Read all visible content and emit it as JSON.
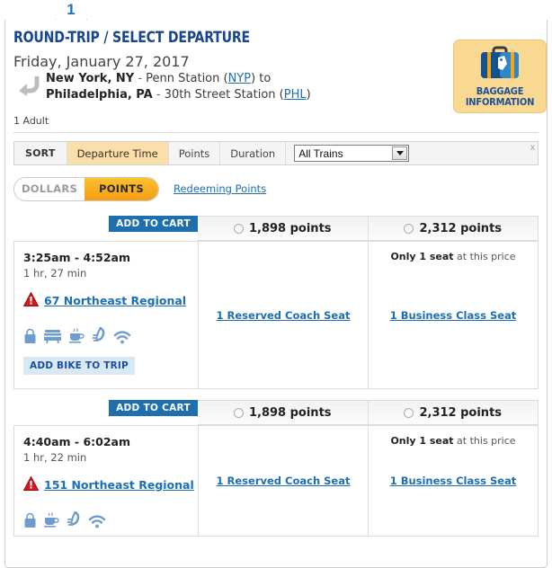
{
  "step": {
    "number": "1"
  },
  "header": {
    "title": "ROUND-TRIP / SELECT DEPARTURE",
    "date": "Friday, January 27, 2017",
    "origin_city": "New York, NY",
    "origin_sep": " - ",
    "origin_station": "Penn Station (",
    "origin_code": "NYP",
    "origin_tail": ") to",
    "dest_city": "Philadelphia, PA",
    "dest_sep": " - ",
    "dest_station": "30th Street Station (",
    "dest_code": "PHL",
    "dest_tail": ")",
    "passengers": "1 Adult",
    "baggage_line1": "BAGGAGE",
    "baggage_line2": "INFORMATION",
    "round_trip_icon": "round-trip-arrow-icon",
    "baggage_icon": "suitcase-icon"
  },
  "sort": {
    "label": "SORT",
    "options": [
      {
        "label": "Departure Time",
        "active": true
      },
      {
        "label": "Points",
        "active": false
      },
      {
        "label": "Duration",
        "active": false
      }
    ],
    "train_filter_value": "All Trains",
    "close_label": "x"
  },
  "currency_toggle": {
    "dollars_label": "DOLLARS",
    "points_label": "POINTS",
    "selected": "POINTS",
    "redeem_link": "Redeeming Points"
  },
  "colors": {
    "brand_blue": "#17468f",
    "link_blue": "#1b6fb5",
    "cart_blue": "#1d6fb0",
    "points_orange": "#f49d14",
    "sort_active": "#fbdfaa",
    "baggage_bg": "#f9d991",
    "warning_red": "#d5181f",
    "amenity_blue": "#6e9ccf",
    "bike_bg": "#d9e8f5"
  },
  "results": [
    {
      "add_to_cart": "ADD TO CART",
      "fares": [
        {
          "price": "1,898 points",
          "selected": false
        },
        {
          "price": "2,312 points",
          "selected": false
        }
      ],
      "times": "3:25am - 4:52am",
      "duration": "1 hr, 27 min",
      "train_name": "67 Northeast Regional",
      "warning_icon": "warning-triangle-icon",
      "amenities": [
        "carry-on-bag-icon",
        "food-cart-icon",
        "coffee-cup-icon",
        "quiet-car-icon",
        "wifi-icon"
      ],
      "bike_label": "ADD BIKE TO TRIP",
      "coach": {
        "link": "1 Reserved Coach Seat",
        "note_bold": "",
        "note_rest": ""
      },
      "business": {
        "link": "1 Business Class Seat",
        "note_bold": "Only 1 seat",
        "note_rest": " at this price"
      }
    },
    {
      "add_to_cart": "ADD TO CART",
      "fares": [
        {
          "price": "1,898 points",
          "selected": false
        },
        {
          "price": "2,312 points",
          "selected": false
        }
      ],
      "times": "4:40am - 6:02am",
      "duration": "1 hr, 22 min",
      "train_name": "151 Northeast Regional",
      "warning_icon": "warning-triangle-icon",
      "amenities": [
        "carry-on-bag-icon",
        "coffee-cup-icon",
        "quiet-car-icon",
        "wifi-icon"
      ],
      "bike_label": "",
      "coach": {
        "link": "1 Reserved Coach Seat",
        "note_bold": "",
        "note_rest": ""
      },
      "business": {
        "link": "1 Business Class Seat",
        "note_bold": "Only 1 seat",
        "note_rest": " at this price"
      }
    }
  ]
}
